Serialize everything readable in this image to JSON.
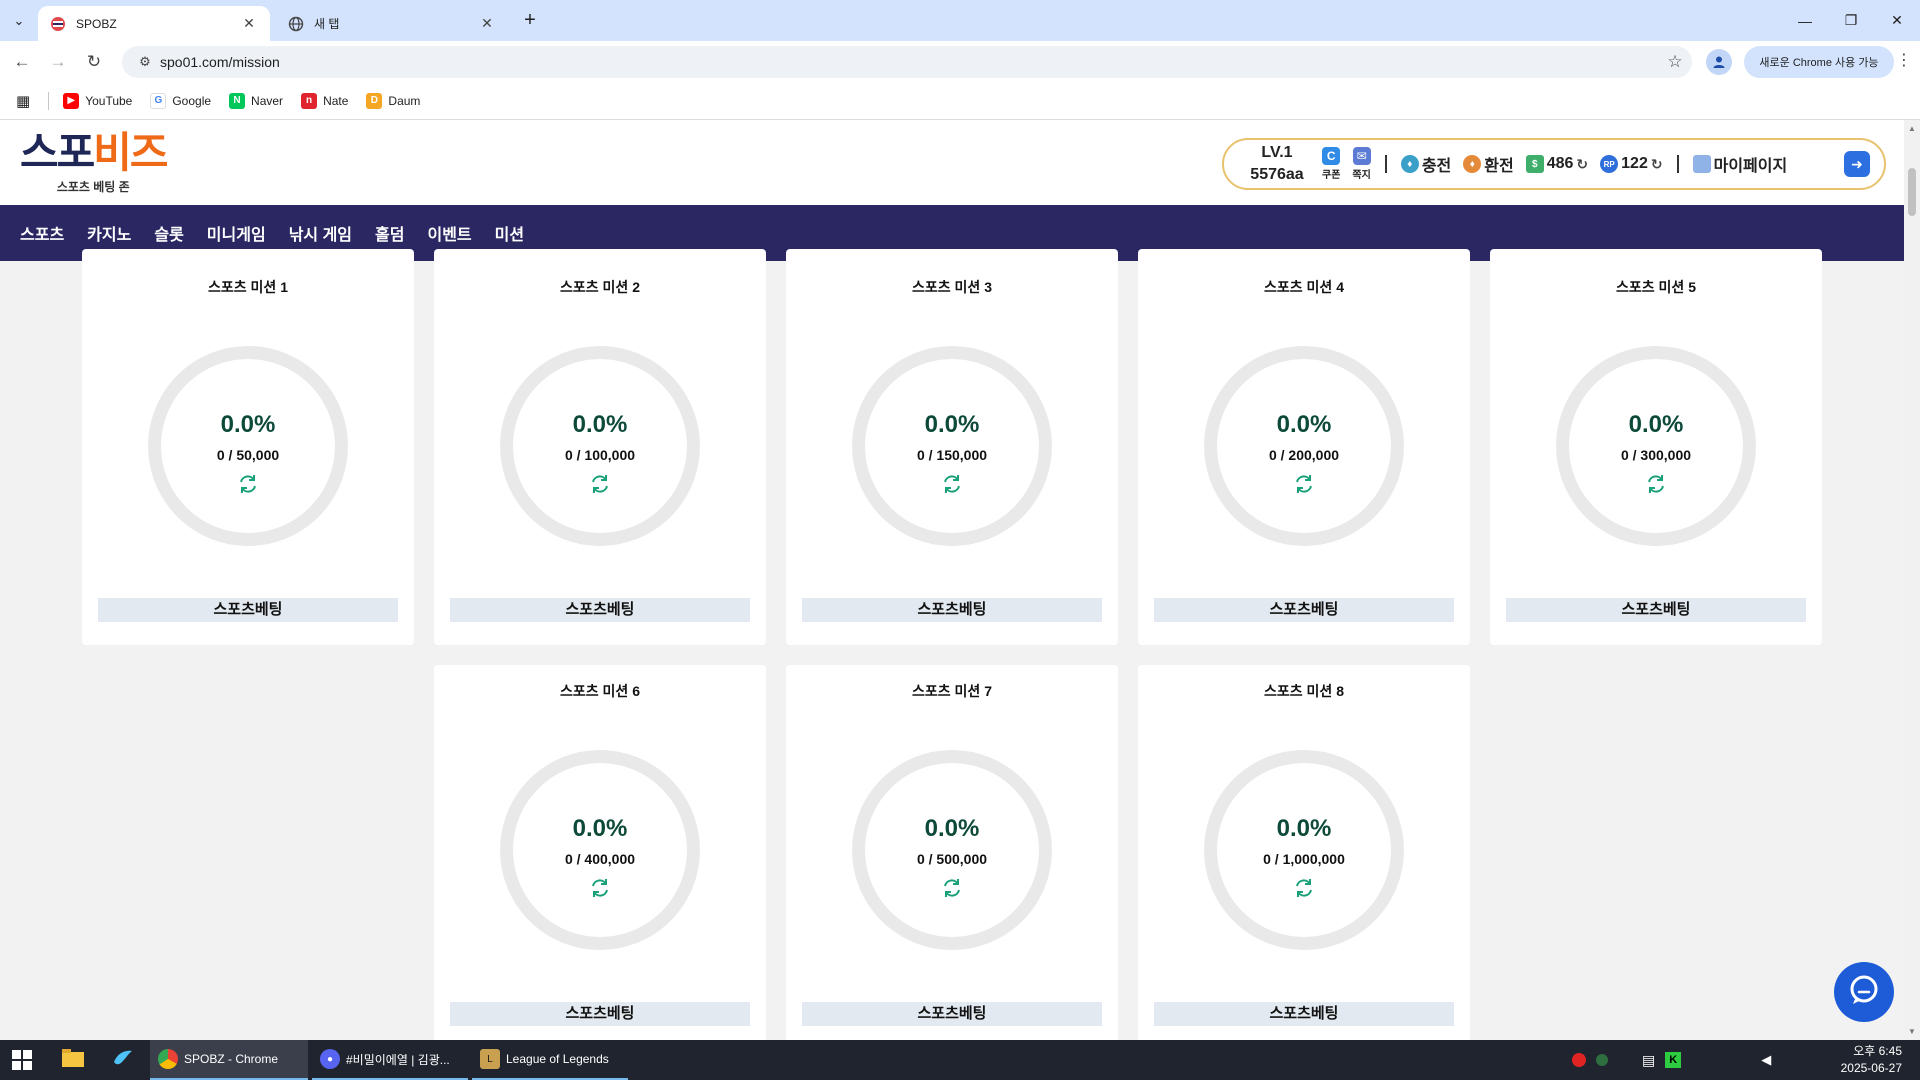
{
  "browser": {
    "tabs": [
      {
        "title": "SPOBZ"
      },
      {
        "title": "새 탭"
      }
    ],
    "url": "spo01.com/mission",
    "new_chrome_label": "새로운 Chrome 사용 가능",
    "bookmarks": [
      {
        "label": "YouTube",
        "color": "#ff0000"
      },
      {
        "label": "Google",
        "color": "#4285f4"
      },
      {
        "label": "Naver",
        "color": "#03c75a"
      },
      {
        "label": "Nate",
        "color": "#e0242d"
      },
      {
        "label": "Daum",
        "color": "#f5a623"
      }
    ]
  },
  "site": {
    "logo": {
      "part1": "스포",
      "part2": "비즈",
      "tagline": "스포츠 베팅 존"
    },
    "user": {
      "level": "LV.1",
      "username": "5576aa",
      "coupon_label": "쿠폰",
      "message_label": "쪽지",
      "deposit_label": "충전",
      "withdraw_label": "환전",
      "money": "486",
      "points": "122",
      "points_badge": "RP",
      "mypage_label": "마이페이지"
    },
    "nav": [
      "스포츠",
      "카지노",
      "슬롯",
      "미니게임",
      "낚시 게임",
      "홀덤",
      "이벤트",
      "미션"
    ],
    "missions": [
      {
        "title": "스포츠 미션 1",
        "percent": "0.0%",
        "amount": "0 / 50,000",
        "tag": "스포츠베팅"
      },
      {
        "title": "스포츠 미션 2",
        "percent": "0.0%",
        "amount": "0 / 100,000",
        "tag": "스포츠베팅"
      },
      {
        "title": "스포츠 미션 3",
        "percent": "0.0%",
        "amount": "0 / 150,000",
        "tag": "스포츠베팅"
      },
      {
        "title": "스포츠 미션 4",
        "percent": "0.0%",
        "amount": "0 / 200,000",
        "tag": "스포츠베팅"
      },
      {
        "title": "스포츠 미션 5",
        "percent": "0.0%",
        "amount": "0 / 300,000",
        "tag": "스포츠베팅"
      },
      {
        "title": "스포츠 미션 6",
        "percent": "0.0%",
        "amount": "0 / 400,000",
        "tag": "스포츠베팅"
      },
      {
        "title": "스포츠 미션 7",
        "percent": "0.0%",
        "amount": "0 / 500,000",
        "tag": "스포츠베팅"
      },
      {
        "title": "스포츠 미션 8",
        "percent": "0.0%",
        "amount": "0 / 1,000,000",
        "tag": "스포츠베팅"
      }
    ],
    "colors": {
      "nav_bg": "#2a2763",
      "logo_orange": "#ef6a17",
      "logo_navy": "#1e2756",
      "percent_text": "#0e4a3a",
      "refresh_icon": "#1aa17a"
    }
  },
  "taskbar": {
    "items": [
      {
        "label": "SPOBZ - Chrome"
      },
      {
        "label": "#비밀이에열 | 김광..."
      },
      {
        "label": "League of Legends"
      }
    ],
    "clock": {
      "time": "오후 6:45",
      "date": "2025-06-27"
    }
  }
}
